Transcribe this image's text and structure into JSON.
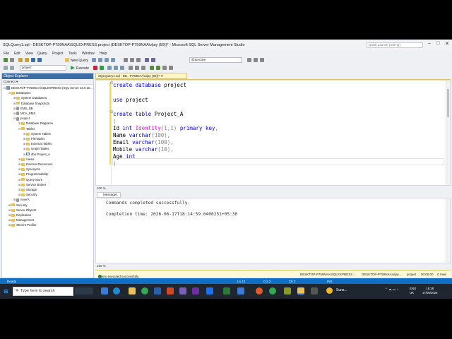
{
  "window": {
    "title": "SQLQuery1.sql - DESKTOP-P759NAA\\SQLEXPRESS.project (DESKTOP-P759NAA\\vijay (59))* - Microsoft SQL Server Management Studio",
    "quick_launch_placeholder": "Quick Launch (Ctrl+Q)"
  },
  "menu": [
    "File",
    "Edit",
    "View",
    "Query",
    "Project",
    "Tools",
    "Window",
    "Help"
  ],
  "toolbar": {
    "new_query": "New Query",
    "execute": "Execute",
    "database_combo": "project",
    "variable_combo": "@IsActive"
  },
  "object_explorer": {
    "title": "Object Explorer",
    "connect": "Connect ▾",
    "nodes": [
      {
        "label": "DESKTOP-P759NAA\\SQLEXPRESS (SQL Server 16.0.10...",
        "level": 0,
        "expander": "⊟",
        "icon": "server"
      },
      {
        "label": "Databases",
        "level": 1,
        "expander": "⊟",
        "icon": "folder"
      },
      {
        "label": "System Databases",
        "level": 2,
        "expander": "⊞",
        "icon": "folder"
      },
      {
        "label": "Database Snapshots",
        "level": 2,
        "expander": "⊞",
        "icon": "folder"
      },
      {
        "label": "EMS_DB",
        "level": 2,
        "expander": "⊞",
        "icon": "db"
      },
      {
        "label": "MCA_EMS",
        "level": 2,
        "expander": "⊞",
        "icon": "db"
      },
      {
        "label": "project",
        "level": 2,
        "expander": "⊟",
        "icon": "db"
      },
      {
        "label": "Database Diagrams",
        "level": 3,
        "expander": "⊞",
        "icon": "folder"
      },
      {
        "label": "Tables",
        "level": 3,
        "expander": "⊟",
        "icon": "folder"
      },
      {
        "label": "System Tables",
        "level": 4,
        "expander": "⊞",
        "icon": "folder"
      },
      {
        "label": "FileTables",
        "level": 4,
        "expander": "⊞",
        "icon": "folder"
      },
      {
        "label": "External Tables",
        "level": 4,
        "expander": "⊞",
        "icon": "folder"
      },
      {
        "label": "Graph Tables",
        "level": 4,
        "expander": "⊞",
        "icon": "folder"
      },
      {
        "label": "dbo.Project_A",
        "level": 4,
        "expander": "⊞",
        "icon": "table"
      },
      {
        "label": "Views",
        "level": 3,
        "expander": "⊞",
        "icon": "folder"
      },
      {
        "label": "External Resources",
        "level": 3,
        "expander": "⊞",
        "icon": "folder"
      },
      {
        "label": "Synonyms",
        "level": 3,
        "expander": "⊞",
        "icon": "folder"
      },
      {
        "label": "Programmability",
        "level": 3,
        "expander": "⊞",
        "icon": "folder"
      },
      {
        "label": "Query Store",
        "level": 3,
        "expander": "⊞",
        "icon": "folder"
      },
      {
        "label": "Service Broker",
        "level": 3,
        "expander": "⊞",
        "icon": "folder"
      },
      {
        "label": "Storage",
        "level": 3,
        "expander": "⊞",
        "icon": "folder"
      },
      {
        "label": "Security",
        "level": 3,
        "expander": "⊞",
        "icon": "folder"
      },
      {
        "label": "reverA",
        "level": 2,
        "expander": "⊞",
        "icon": "db"
      },
      {
        "label": "Security",
        "level": 1,
        "expander": "⊞",
        "icon": "folder"
      },
      {
        "label": "Server Objects",
        "level": 1,
        "expander": "⊞",
        "icon": "folder"
      },
      {
        "label": "Replication",
        "level": 1,
        "expander": "⊞",
        "icon": "folder"
      },
      {
        "label": "Management",
        "level": 1,
        "expander": "⊞",
        "icon": "folder"
      },
      {
        "label": "XEvent Profiler",
        "level": 1,
        "expander": "⊞",
        "icon": "folder"
      }
    ]
  },
  "doc_tab": "SQLQuery1.sql - DE...P759NAA\\vijay (59))*  ✕",
  "editor": {
    "line1": {
      "kw": "create database",
      "rest": " project"
    },
    "line2": {
      "kw": "use",
      "rest": " project"
    },
    "line3": {
      "kw": "create table",
      "rest": " Project_A"
    },
    "line4": "(",
    "line5": {
      "a": "Id ",
      "b": "int ",
      "c": "Identity",
      "d": "(1,1) ",
      "e": "primary key",
      "f": ","
    },
    "line6": {
      "a": "Name ",
      "b": "varchar",
      "c": "(100),"
    },
    "line7": {
      "a": "Email ",
      "b": "varchar",
      "c": "(100),"
    },
    "line8": {
      "a": "Mobile ",
      "b": "varchar",
      "c": "(10),"
    },
    "line9": {
      "a": "Age ",
      "b": "int"
    },
    "line10": ")"
  },
  "zoom_editor": "100 %",
  "messages_tab": "Messages",
  "results": {
    "line1": "Commands completed successfully.",
    "line2": "Completion time: 2026-06-17T18:14:59.6400251+05:30"
  },
  "zoom_results": "150 %",
  "query_status": {
    "message": "Query executed successfully.",
    "server": "DESKTOP-P759NAA\\SQLEXPRESS ...",
    "user": "DESKTOP-P759NAA\\vijay ...",
    "db": "project",
    "time": "00:00:00",
    "rows": "0 rows"
  },
  "statusbar": {
    "ready": "Ready",
    "ln": "Ln 12",
    "col": "Col 2",
    "ch": "Ch 2",
    "ins": "INS"
  },
  "taskbar": {
    "search_placeholder": "Type here to search",
    "weather": "Suns...",
    "lang1": "ENG",
    "lang2": "UK",
    "time": "18:38",
    "date": "17/06/2026"
  },
  "colors": {
    "accent": "#0e6fc5",
    "keyword": "#0000ff",
    "function": "#ff00ff"
  }
}
